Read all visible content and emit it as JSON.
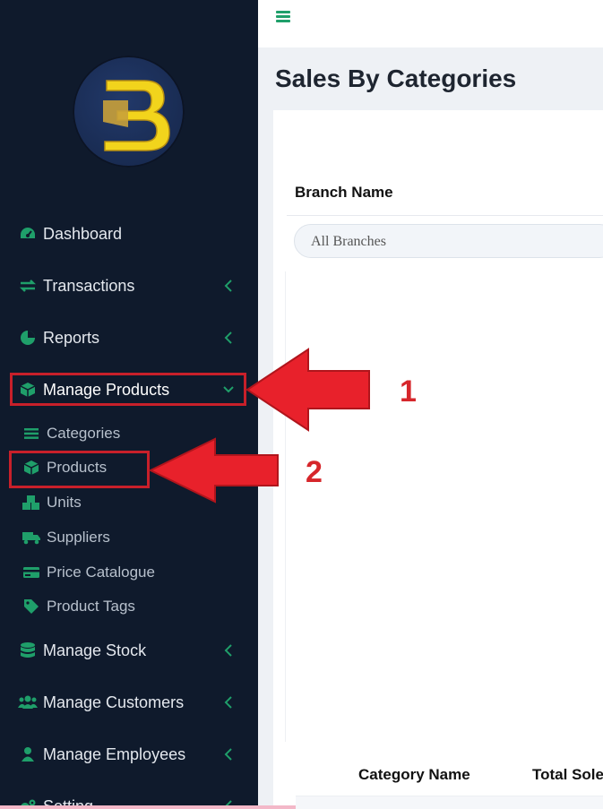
{
  "sidebar": {
    "logo": {
      "letter": "B",
      "alt": "brand-logo"
    },
    "items": [
      {
        "label": "Dashboard",
        "icon": "dashboard-gauge-icon"
      },
      {
        "label": "Transactions",
        "icon": "exchange-arrows-icon",
        "chevron": "chevron-left-icon"
      },
      {
        "label": "Reports",
        "icon": "pie-chart-icon",
        "chevron": "chevron-left-icon"
      },
      {
        "label": "Manage Products",
        "icon": "cube-icon",
        "chevron": "chevron-down-icon",
        "expanded": true
      },
      {
        "label": "Manage Stock",
        "icon": "database-icon",
        "chevron": "chevron-left-icon"
      },
      {
        "label": "Manage Customers",
        "icon": "users-icon",
        "chevron": "chevron-left-icon"
      },
      {
        "label": "Manage Employees",
        "icon": "user-icon",
        "chevron": "chevron-left-icon"
      },
      {
        "label": "Setting",
        "icon": "gears-icon",
        "chevron": "chevron-left-icon"
      }
    ],
    "subitems": [
      {
        "label": "Categories",
        "icon": "list-icon"
      },
      {
        "label": "Products",
        "icon": "cube-icon"
      },
      {
        "label": "Units",
        "icon": "cubes-icon"
      },
      {
        "label": "Suppliers",
        "icon": "truck-icon"
      },
      {
        "label": "Price Catalogue",
        "icon": "credit-card-icon"
      },
      {
        "label": "Product Tags",
        "icon": "tag-icon"
      }
    ]
  },
  "main": {
    "page_title": "Sales By Categories",
    "branch_label": "Branch Name",
    "branch_select": {
      "selected": "All Branches"
    },
    "table": {
      "columns": [
        "Category Name",
        "Total Sole"
      ]
    }
  },
  "annotations": {
    "first": "1",
    "second": "2"
  },
  "colors": {
    "sidebar_bg": "#0f1a2c",
    "accent_green": "#1f9f6a",
    "annotation_red": "#d6262b",
    "logo_yellow": "#f2d41c"
  }
}
